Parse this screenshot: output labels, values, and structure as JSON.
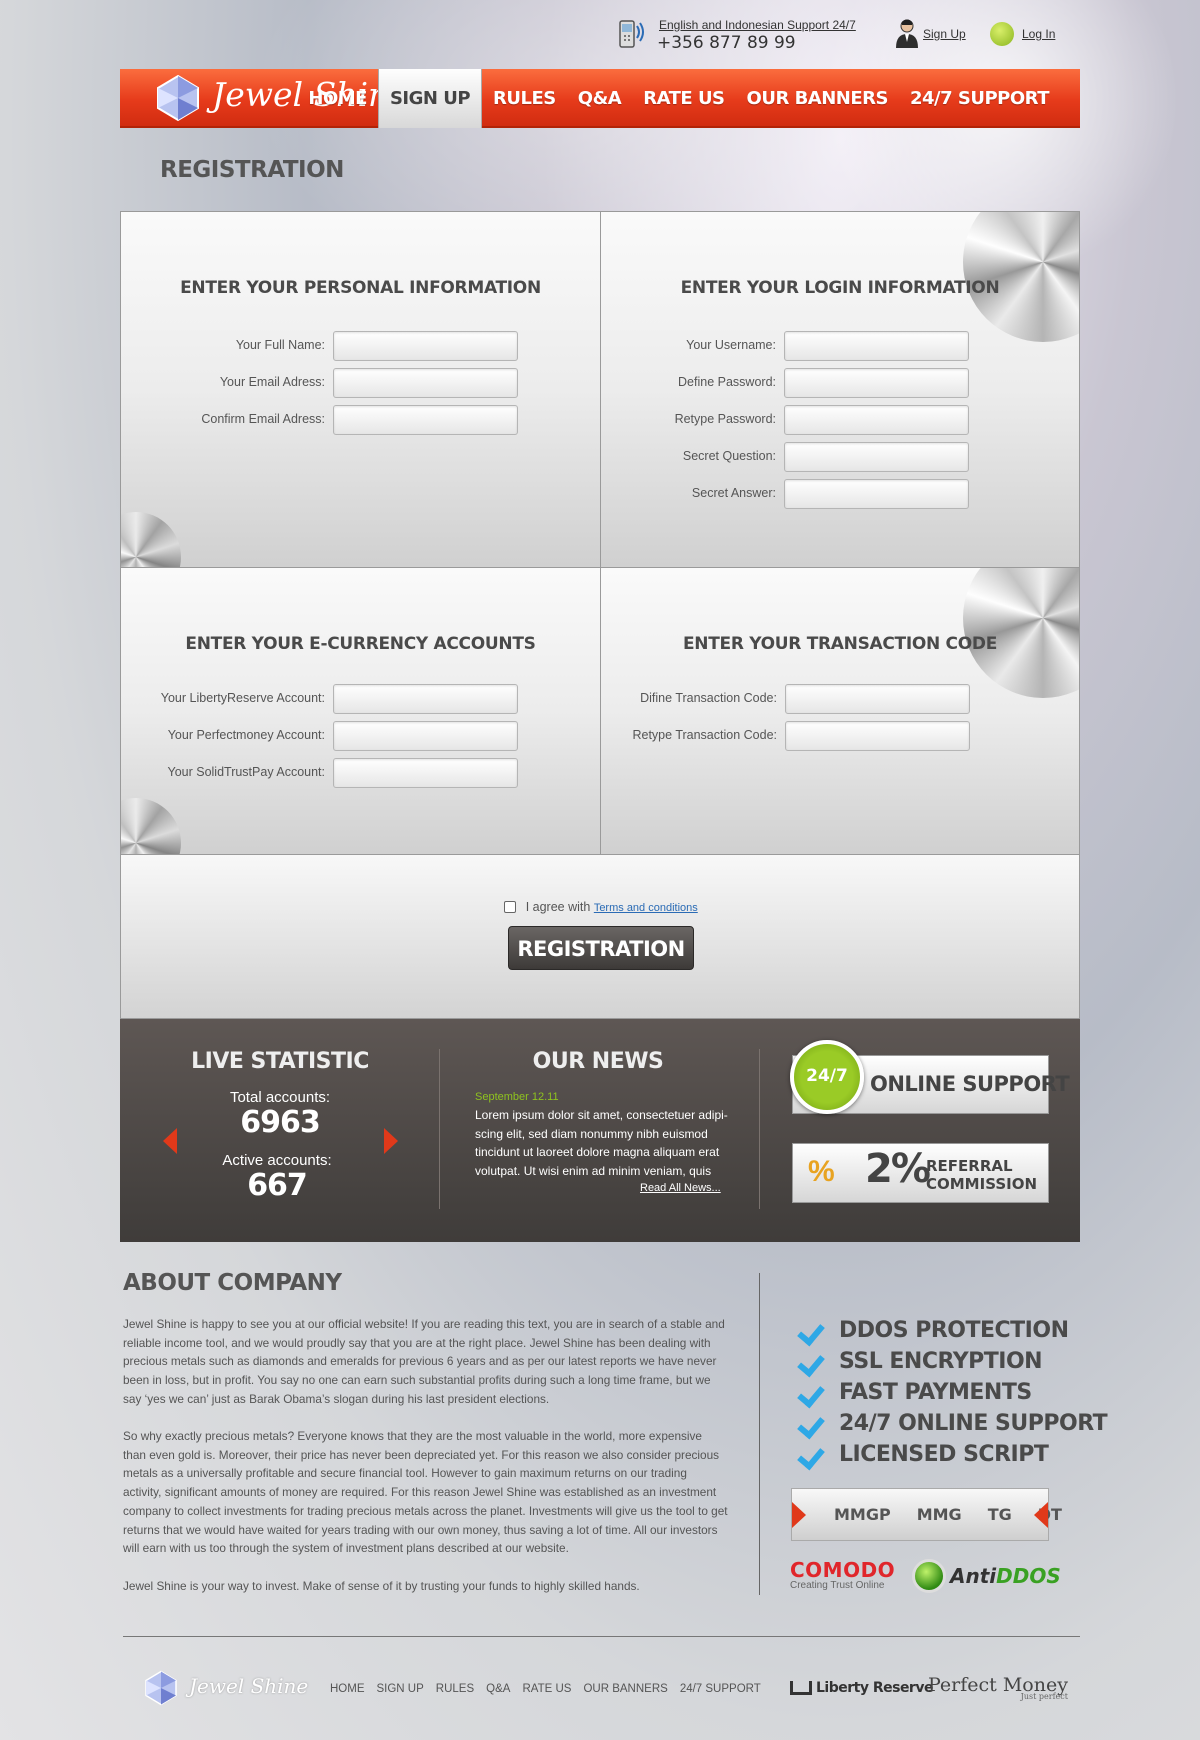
{
  "topbar": {
    "support_text": "English and Indonesian Support 24/7",
    "phone": "+356 877 89 99",
    "signup": "Sign Up",
    "login": "Log In"
  },
  "brand": {
    "name": "Jewel Shine"
  },
  "nav": {
    "items": [
      {
        "label": "HOME",
        "active": false
      },
      {
        "label": "SIGN UP",
        "active": true
      },
      {
        "label": "RULES",
        "active": false
      },
      {
        "label": "Q&A",
        "active": false
      },
      {
        "label": "RATE US",
        "active": false
      },
      {
        "label": "OUR BANNERS",
        "active": false
      },
      {
        "label": "24/7 SUPPORT",
        "active": false
      }
    ]
  },
  "page_title": "REGISTRATION",
  "personal": {
    "title": "ENTER YOUR PERSONAL INFORMATION",
    "fields": [
      "Your Full Name:",
      "Your Email Adress:",
      "Confirm Email Adress:"
    ]
  },
  "login_info": {
    "title": "ENTER YOUR LOGIN INFORMATION",
    "fields": [
      "Your Username:",
      "Define Password:",
      "Retype Password:",
      "Secret Question:",
      "Secret Answer:"
    ]
  },
  "ecurrency": {
    "title": "ENTER YOUR E-CURRENCY ACCOUNTS",
    "fields": [
      "Your LibertyReserve Account:",
      "Your Perfectmoney Account:",
      "Your SolidTrustPay Account:"
    ]
  },
  "transaction": {
    "title": "ENTER YOUR TRANSACTION CODE",
    "fields": [
      "Difine Transaction Code:",
      "Retype Transaction Code:"
    ]
  },
  "agree": {
    "text": "I agree with",
    "terms": "Terms and conditions",
    "checked": false,
    "button": "REGISTRATION"
  },
  "stats": {
    "title": "LIVE STATISTIC",
    "total_label": "Total accounts:",
    "total_value": "6963",
    "active_label": "Active accounts:",
    "active_value": "667"
  },
  "news": {
    "title": "OUR NEWS",
    "date": "September 12.11",
    "body": "Lorem ipsum dolor sit amet, consectetuer adipi-scing elit, sed diam nonummy nibh euismod tincidunt ut laoreet dolore magna aliquam erat volutpat. Ut wisi enim ad minim veniam, quis",
    "read_all": "Read All News..."
  },
  "support": {
    "badge": "24/7",
    "label": "ONLINE SUPPORT"
  },
  "referral": {
    "value": "2%",
    "label": "REFERRAL COMMISSION"
  },
  "about": {
    "title": "ABOUT COMPANY",
    "paragraphs": [
      "Jewel Shine is happy to see you at our official website! If you are reading this text, you are in search of a stable and reliable income tool, and we would proudly say that you are at the right place. Jewel Shine has been dealing with precious metals such as diamonds and emeralds for previous 6 years and as per our latest reports we have never been in loss, but in profit. You say no one can earn such substantial profits during such a long time frame, but we say ‘yes we can’ just as Barak Obama’s slogan during his last president elections.",
      "So why exactly precious metals? Everyone knows that they are the most valuable in the world, more expensive than even gold is. Moreover, their price has never been depreciated yet. For this reason we also consider precious metals as a universally profitable and secure financial tool. However to gain maximum returns on our trading activity, significant amounts of money are required. For this reason Jewel Shine was established as an investment company to collect investments for trading precious metals across the planet. Investments will give us the tool to get returns that we would have waited for years trading with our own money, thus saving a lot of time. All our investors will earn with us too through the system of investment plans described at our website.",
      "Jewel Shine is your way to invest. Make of sense of it by trusting your funds to highly skilled hands."
    ]
  },
  "features": [
    "DDOS PROTECTION",
    "SSL ENCRYPTION",
    "FAST PAYMENTS",
    "24/7 ONLINE SUPPORT",
    "LICENSED SCRIPT"
  ],
  "monitors": [
    "MMGP",
    "MMG",
    "TG",
    "DT"
  ],
  "badges": {
    "comodo": "COMODO",
    "comodo_sub": "Creating Trust Online",
    "antiddos_a": "Anti",
    "antiddos_b": "DDOS"
  },
  "footer": {
    "nav": [
      "HOME",
      "SIGN UP",
      "RULES",
      "Q&A",
      "RATE US",
      "OUR BANNERS",
      "24/7 SUPPORT"
    ],
    "liberty": "Liberty Reserve",
    "perfect": "Perfect Money",
    "perfect_sub": "Just perfect"
  },
  "colors": {
    "accent": "#e63b1b",
    "dark_band": "#4f4a47",
    "check": "#2ea8e6",
    "news_date": "#8fc31f"
  }
}
